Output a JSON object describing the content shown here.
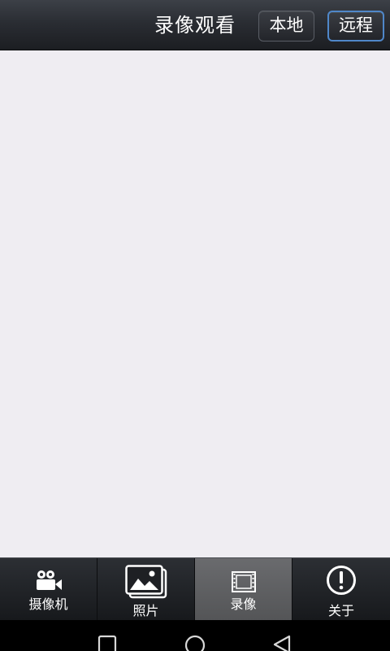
{
  "header": {
    "title": "录像观看",
    "local_label": "本地",
    "remote_label": "远程"
  },
  "tabs": [
    {
      "label": "摄像机",
      "icon": "camera-icon",
      "active": false
    },
    {
      "label": "照片",
      "icon": "photo-icon",
      "active": false
    },
    {
      "label": "录像",
      "icon": "film-icon",
      "active": true
    },
    {
      "label": "关于",
      "icon": "info-icon",
      "active": false
    }
  ],
  "navbar": {
    "buttons": [
      "recents-icon",
      "home-icon",
      "back-icon"
    ]
  },
  "colors": {
    "content_bg": "#efedf2",
    "active_tab_bg": "#606163",
    "remote_border": "#4f87c9"
  }
}
